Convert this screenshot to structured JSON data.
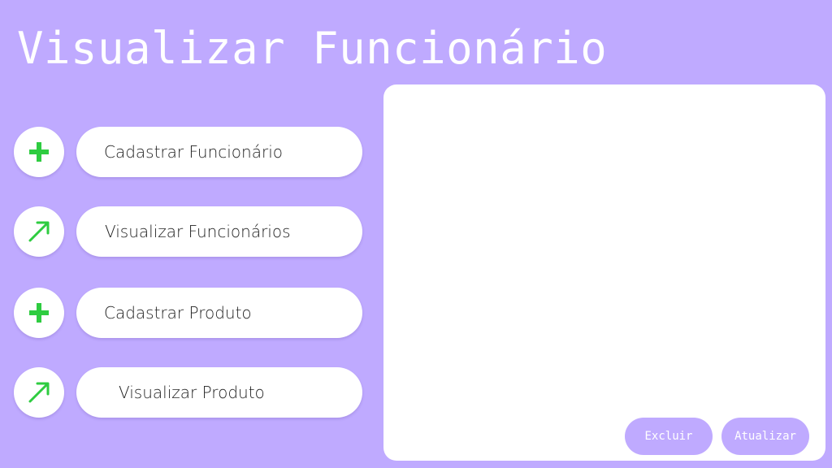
{
  "header": {
    "title": "Visualizar Funcionário"
  },
  "menu": {
    "items": [
      {
        "label": "Cadastrar Funcionário",
        "icon": "plus-icon"
      },
      {
        "label": "Visualizar Funcionários",
        "icon": "arrow-up-right-icon"
      },
      {
        "label": "Cadastrar Produto",
        "icon": "plus-icon"
      },
      {
        "label": "Visualizar Produto",
        "icon": "arrow-up-right-icon"
      }
    ]
  },
  "panel": {
    "delete_label": "Excluir",
    "update_label": "Atualizar"
  },
  "colors": {
    "background": "#bfaaff",
    "icon_green": "#2ecc40",
    "surface": "#ffffff"
  }
}
